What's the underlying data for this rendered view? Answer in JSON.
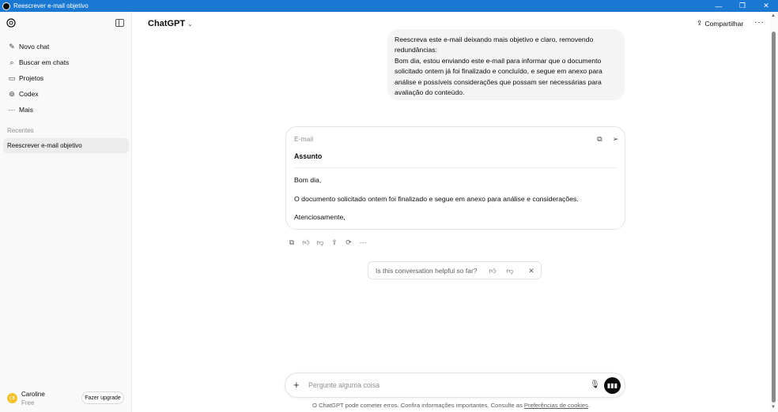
{
  "window": {
    "title": "Reescrever e-mail objetivo",
    "controls": {
      "minimize": "—",
      "restore": "❐",
      "close": "✕"
    }
  },
  "sidebar": {
    "items": [
      {
        "label": "Novo chat",
        "icon": "edit-icon",
        "glyph": "✎"
      },
      {
        "label": "Buscar em chats",
        "icon": "search-icon",
        "glyph": "⌕"
      },
      {
        "label": "Projetos",
        "icon": "folder-icon",
        "glyph": "▭"
      },
      {
        "label": "Codex",
        "icon": "codex-icon",
        "glyph": "⊚"
      },
      {
        "label": "Mais",
        "icon": "more-icon",
        "glyph": "···"
      }
    ],
    "section_label": "Recentes",
    "recent_chat": "Reescrever e-mail objetivo",
    "user": {
      "name": "Caroline",
      "plan": "Free",
      "avatar_text": "CB",
      "avatar_color": "#f2c12e"
    },
    "upgrade_label": "Fazer upgrade"
  },
  "header": {
    "model": "ChatGPT",
    "share_label": "Compartilhar"
  },
  "conversation": {
    "user_message": "Reescreva este e-mail deixando mais objetivo e claro, removendo\nredundâncias:\nBom dia, estou enviando este e-mail para informar que o documento\nsolicitado ontem já foi finalizado e concluído, e segue em anexo para\nanálise e possíveis considerações que possam ser necessárias para\navaliação do conteúdo.",
    "email_card": {
      "label": "E-mail",
      "subject": "Assunto",
      "greeting": "Bom dia,",
      "body": "O documento solicitado ontem foi finalizado e segue em anexo para análise e considerações.",
      "closing": "Atenciosamente,"
    },
    "feedback": {
      "question": "Is this conversation helpful so far?"
    }
  },
  "composer": {
    "placeholder": "Pergunte alguma coisa"
  },
  "footer": {
    "note": "O ChatGPT pode cometer erros. Confira informações importantes. Consulte as ",
    "link": "Preferências de cookies",
    "end": "."
  },
  "colors": {
    "titlebar": "#1a78d2",
    "sidebar_bg": "#f9f9f9",
    "bubble_bg": "#f4f4f4"
  }
}
